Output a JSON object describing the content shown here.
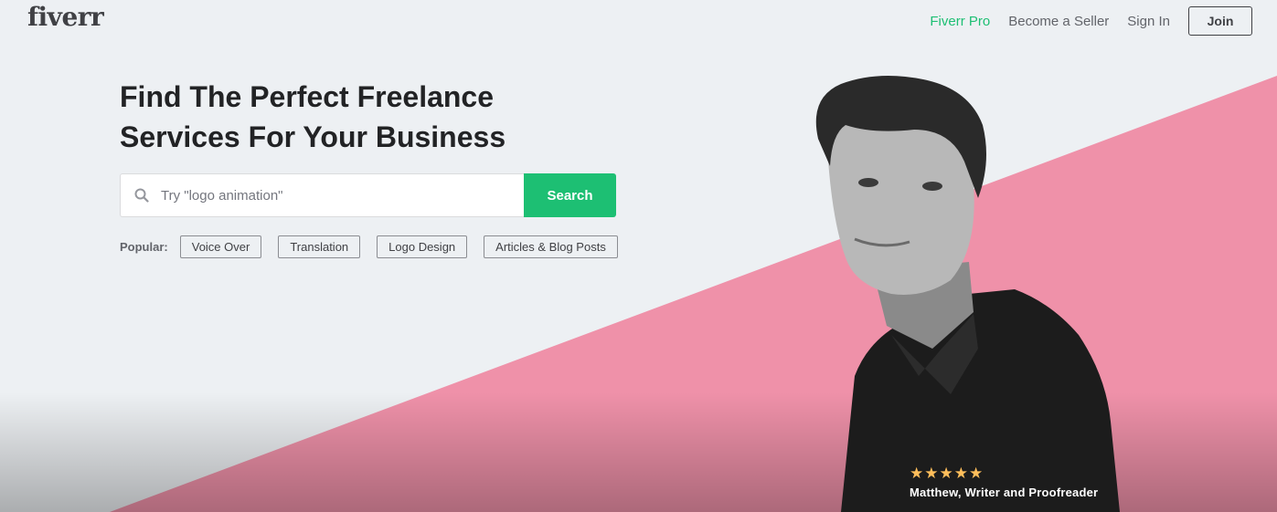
{
  "header": {
    "logo_text": "fiverr",
    "nav": {
      "pro_label": "Fiverr Pro",
      "seller_label": "Become a Seller",
      "signin_label": "Sign In",
      "join_label": "Join"
    }
  },
  "hero": {
    "headline_line1": "Find The Perfect Freelance",
    "headline_line2": "Services For Your Business",
    "search": {
      "placeholder": "Try \"logo animation\"",
      "value": "",
      "button_label": "Search",
      "icon": "search-icon"
    },
    "popular": {
      "label": "Popular:",
      "tags": [
        "Voice Over",
        "Translation",
        "Logo Design",
        "Articles & Blog Posts"
      ]
    },
    "testimonial": {
      "rating": 5,
      "stars": "★★★★★",
      "caption": "Matthew, Writer and Proofreader"
    }
  },
  "colors": {
    "brand_green": "#1dbf73",
    "background": "#edf0f3",
    "pink": "#ef91a9",
    "star": "#ffbe5b",
    "text_dark": "#222325"
  }
}
